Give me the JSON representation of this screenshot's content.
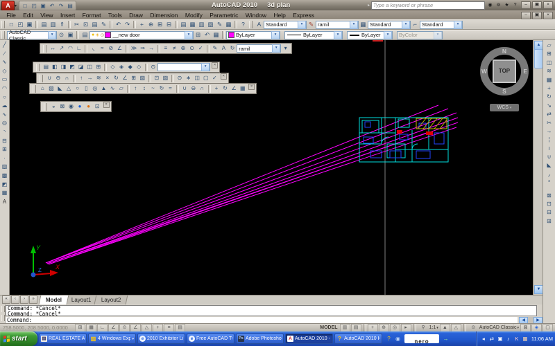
{
  "window": {
    "app_title": "AutoCAD 2010",
    "doc_title": "3d plan",
    "search_placeholder": "Type a keyword or phrase"
  },
  "menus": [
    "File",
    "Edit",
    "View",
    "Insert",
    "Format",
    "Tools",
    "Draw",
    "Dimension",
    "Modify",
    "Parametric",
    "Window",
    "Help",
    "Express"
  ],
  "styles": {
    "text_style": "Standard",
    "dim_style": "ramil",
    "table_style": "Standard",
    "multileader_style": "Standard"
  },
  "workspace": "AutoCAD Classic",
  "layer": {
    "name": "__new door"
  },
  "props": {
    "color": "ByLayer",
    "linetype": "ByLayer",
    "lineweight": "ByLayer",
    "plot_style": "ByColor"
  },
  "dim_combo": "ramil",
  "view_combo": "",
  "viewcube": {
    "n": "N",
    "e": "E",
    "s": "S",
    "w": "W",
    "face": "TOP",
    "cs": "WCS"
  },
  "ucs": {
    "x": "X",
    "y": "Y",
    "z": "Z"
  },
  "tabs": {
    "model": "Model",
    "layout1": "Layout1",
    "layout2": "Layout2"
  },
  "command": {
    "line1": "Command: *Cancel*",
    "line2": "Command: *Cancel*",
    "prompt": "Command:"
  },
  "status": {
    "coords": "758.5000, 208.5000, 0.0000",
    "model": "MODEL",
    "scale": "1:1",
    "workspace": "AutoCAD Classic"
  },
  "taskbar": {
    "start": "start",
    "tasks": [
      {
        "label": "REAL ESTATE AP..."
      },
      {
        "label": "4 Windows Expl..."
      },
      {
        "label": "2010 Exhibitor Li..."
      },
      {
        "label": "Free AutoCAD Tu..."
      },
      {
        "label": "Adobe Photosho..."
      },
      {
        "label": "AutoCAD 2010 - ..."
      },
      {
        "label": "AutoCAD 2010 Help"
      }
    ],
    "nero": "nero",
    "time": "11:06 AM"
  },
  "colors": {
    "magenta": "#ff00ff",
    "cyan": "#00e8e8",
    "plan_blue": "#2244ff",
    "hatch_yellow": "#c8b400",
    "ucs_green": "#00c000",
    "ucs_red": "#d00000",
    "ucs_blue": "#2b6bd6",
    "taskbar_blue": "#2158cd",
    "start_green": "#3d9a35",
    "crosshair_gray": "#808080"
  },
  "toolbars": {
    "qat": [
      "qnew",
      "open",
      "save",
      "undo",
      "redo",
      "plot"
    ],
    "standard": [
      "qnew",
      "open",
      "save",
      "|",
      "plot",
      "plot-preview",
      "publish",
      "|",
      "cut",
      "copy-clip",
      "paste",
      "match-properties",
      "|",
      "undo",
      "redo",
      "|",
      "pan-realtime",
      "zoom-realtime",
      "zoom-window",
      "zoom-previous",
      "|",
      "properties",
      "designcenter",
      "tool-palettes",
      "sheet-set-manager",
      "markup-set-manager",
      "quickcalc",
      "|",
      "help"
    ],
    "workspace_icons": [
      "workspace-settings",
      "save-workspace"
    ],
    "layer_icons_after": [
      "make-current",
      "layer-previous",
      "layer-states"
    ],
    "dimension": [
      "linear",
      "aligned",
      "arc-length",
      "ordinate",
      "|",
      "radius",
      "jogged",
      "diameter",
      "angular",
      "|",
      "quick-dim",
      "baseline",
      "continue",
      "|",
      "dim-space",
      "dim-break",
      "tolerance",
      "center-mark",
      "inspect",
      "|",
      "dim-edit",
      "dim-text-edit",
      "dim-update"
    ],
    "view": [
      "named-views",
      "top-view",
      "bottom-view",
      "left-view",
      "right-view",
      "front-view",
      "back-view",
      "|",
      "sw-iso",
      "se-iso",
      "ne-iso",
      "nw-iso",
      "|",
      "create-camera"
    ],
    "solid_editing": [
      "union",
      "subtract",
      "intersect",
      "|",
      "extrude-faces",
      "move-faces",
      "offset-faces",
      "delete-faces",
      "rotate-faces",
      "taper-faces",
      "copy-faces",
      "color-faces",
      "|",
      "copy-edges",
      "color-edges",
      "|",
      "imprint",
      "clean",
      "separate",
      "shell",
      "check"
    ],
    "modeling": [
      "polysolid",
      "box",
      "wedge",
      "cone",
      "sphere",
      "cylinder",
      "torus",
      "pyramid",
      "helix",
      "planar-surface",
      "|",
      "extrude",
      "presspull",
      "sweep",
      "revolve",
      "loft",
      "|",
      "union",
      "subtract",
      "intersect",
      "|",
      "3d-move",
      "3d-rotate",
      "3d-align",
      "3d-array"
    ],
    "render": [
      "hide",
      "render-region",
      "render",
      "render-environment",
      "advanced-render-settings",
      "render-window"
    ],
    "draw": [
      "line",
      "construction-line",
      "polyline",
      "polygon",
      "rectangle",
      "arc",
      "circle",
      "revision-cloud",
      "spline",
      "ellipse",
      "ellipse-arc",
      "insert-block",
      "make-block",
      "point",
      "hatch",
      "gradient",
      "region",
      "table",
      "multiline-text"
    ],
    "modify": [
      "erase",
      "copy",
      "mirror",
      "offset",
      "array",
      "move",
      "rotate",
      "scale",
      "stretch",
      "trim",
      "extend",
      "break-at-point",
      "break",
      "join",
      "chamfer",
      "fillet",
      "explode"
    ],
    "order": [
      "bring-to-front",
      "send-to-back",
      "bring-above",
      "send-under"
    ],
    "titlebar_tools": [
      "search",
      "communication-center",
      "favorites",
      "help"
    ],
    "status_toggles": [
      "snap",
      "grid",
      "ortho",
      "polar",
      "osnap",
      "otrack",
      "ducs",
      "dyn",
      "lwt",
      "qp"
    ],
    "status_quickview": [
      "quick-view-layouts",
      "quick-view-drawings"
    ],
    "status_nav": [
      "pan",
      "zoom",
      "steering-wheel",
      "showmotion"
    ],
    "status_annot": [
      "annotation-visibility",
      "auto-scale"
    ],
    "status_lock": [
      "toolbar-lock"
    ],
    "tray": [
      "hidden-chevron",
      "tray-network",
      "tray-display",
      "tray-volume",
      "tray-kaspersky",
      "tray-calendar"
    ]
  },
  "icon_glyphs": {
    "qnew": "□",
    "open": "◰",
    "save": "▣",
    "plot": "▤",
    "plot-preview": "▥",
    "publish": "⇑",
    "cut": "✂",
    "copy-clip": "⊡",
    "paste": "▤",
    "match-properties": "✎",
    "undo": "↶",
    "redo": "↷",
    "pan-realtime": "+",
    "zoom-realtime": "⊕",
    "zoom-window": "⊞",
    "zoom-previous": "⊟",
    "properties": "▤",
    "designcenter": "▦",
    "tool-palettes": "▥",
    "sheet-set-manager": "▧",
    "markup-set-manager": "✎",
    "quickcalc": "▦",
    "help": "?",
    "workspace-settings": "⊙",
    "save-workspace": "▣",
    "layers": "▤",
    "make-current": "⊞",
    "layer-previous": "↶",
    "layer-states": "▦",
    "text-style": "A",
    "dim-style": "✎",
    "table-style": "▦",
    "multileader-style": "⌐",
    "linear": "↔",
    "aligned": "↗",
    "arc-length": "◠",
    "ordinate": "∟",
    "radius": "◟",
    "jogged": "≈",
    "diameter": "⊘",
    "angular": "∠",
    "quick-dim": "≫",
    "baseline": "⇒",
    "continue": "→",
    "dim-space": "≡",
    "dim-break": "≠",
    "tolerance": "⊕",
    "center-mark": "⊙",
    "inspect": "✓",
    "dim-edit": "✎",
    "dim-text-edit": "A",
    "dim-update": "↻",
    "named-views": "▤",
    "top-view": "◧",
    "bottom-view": "◨",
    "left-view": "◩",
    "right-view": "◪",
    "front-view": "◫",
    "back-view": "⊞",
    "sw-iso": "◇",
    "se-iso": "◈",
    "ne-iso": "◆",
    "nw-iso": "◇",
    "create-camera": "⊙",
    "union": "∪",
    "subtract": "⊖",
    "intersect": "∩",
    "extrude-faces": "↑",
    "move-faces": "→",
    "offset-faces": "≋",
    "delete-faces": "×",
    "rotate-faces": "↻",
    "taper-faces": "∠",
    "copy-faces": "⊞",
    "color-faces": "▨",
    "copy-edges": "⊡",
    "color-edges": "▧",
    "imprint": "⊙",
    "clean": "∗",
    "separate": "◫",
    "shell": "▢",
    "check": "✓",
    "polysolid": "⌂",
    "box": "▧",
    "wedge": "◣",
    "cone": "△",
    "sphere": "○",
    "cylinder": "▯",
    "torus": "◎",
    "pyramid": "▲",
    "helix": "∿",
    "planar-surface": "▱",
    "extrude": "↑",
    "presspull": "↕",
    "sweep": "~",
    "revolve": "↻",
    "loft": "≈",
    "3d-move": "+",
    "3d-rotate": "↻",
    "3d-align": "∠",
    "3d-array": "▦",
    "hide": "◒",
    "render-region": "⊠",
    "render": "◉",
    "render-environment": "●",
    "advanced-render-settings": "●",
    "render-window": "⊡",
    "line": "╱",
    "construction-line": "∕",
    "polyline": "∿",
    "polygon": "◇",
    "rectangle": "▭",
    "arc": "◠",
    "circle": "○",
    "revision-cloud": "☁",
    "spline": "∿",
    "ellipse": "◎",
    "ellipse-arc": "◝",
    "insert-block": "⊟",
    "make-block": "⊞",
    "point": "·",
    "hatch": "▨",
    "gradient": "▩",
    "region": "◩",
    "table": "▦",
    "multiline-text": "A",
    "erase": "▱",
    "copy": "⊞",
    "mirror": "◫",
    "offset": "≋",
    "array": "▦",
    "move": "+",
    "rotate": "↻",
    "scale": "↘",
    "stretch": "⇄",
    "trim": "✂",
    "extend": "→",
    "break-at-point": "¦",
    "break": "≀",
    "join": "∪",
    "chamfer": "◣",
    "fillet": "◞",
    "explode": "*",
    "bring-to-front": "⊠",
    "send-to-back": "⊡",
    "bring-above": "⊟",
    "send-under": "⊞",
    "search": "◉",
    "communication-center": "⊚",
    "favorites": "★",
    "snap": "⊞",
    "grid": "▦",
    "ortho": "∟",
    "polar": "∠",
    "osnap": "⊙",
    "otrack": "∠",
    "ducs": "△",
    "dyn": "+",
    "lwt": "≡",
    "qp": "▤",
    "quick-view-layouts": "▥",
    "quick-view-drawings": "▤",
    "pan": "+",
    "zoom": "⊕",
    "steering-wheel": "◎",
    "showmotion": "▸",
    "annotation-visibility": "▲",
    "auto-scale": "△",
    "toolbar-lock": "⊠",
    "app-status": "◈",
    "clean-screen": "▢",
    "hidden-chevron": "◂",
    "tray-network": "⇄",
    "tray-display": "▣",
    "tray-volume": "♪",
    "tray-kaspersky": "K",
    "tray-calendar": "▦",
    "help-bubble": "?",
    "globe": "◉",
    "nero-launcher": "→",
    "dropdown": "▾",
    "expander": "▸",
    "minimize": "–",
    "maximize": "□",
    "restore": "▣",
    "close": "×",
    "person": "⚲",
    "gear": "⊙",
    "lock-small": "⊠",
    "first-tab": "«",
    "prev-tab": "‹",
    "next-tab": "›",
    "last-tab": "»",
    "scroll-up": "▲",
    "scroll-down": "▼",
    "scroll-left": "◀",
    "scroll-right": "▶",
    "bulb": "●",
    "sun": "☀",
    "lock": "⊙",
    "ie": "e",
    "photoshop": "Ps",
    "acad-doc": "A",
    "help-doc": "?",
    "folder": "▨",
    "doc": "▤"
  },
  "icon_colors": {
    "render-environment": "#1b5fd6",
    "advanced-render-settings": "#e07010",
    "tray-kaspersky": "#ffd0d0",
    "tray-calendar": "#ffd9b0",
    "nero-launcher": "#9ef09e",
    "help-bubble": "#f5c518",
    "globe": "#bcd3f5",
    "multiline-text": "#333",
    "text-style": "#333",
    "dim-style": "#a04030",
    "bulb": "#f0c000",
    "sun": "#e8a800",
    "lock": "#b09a50"
  }
}
